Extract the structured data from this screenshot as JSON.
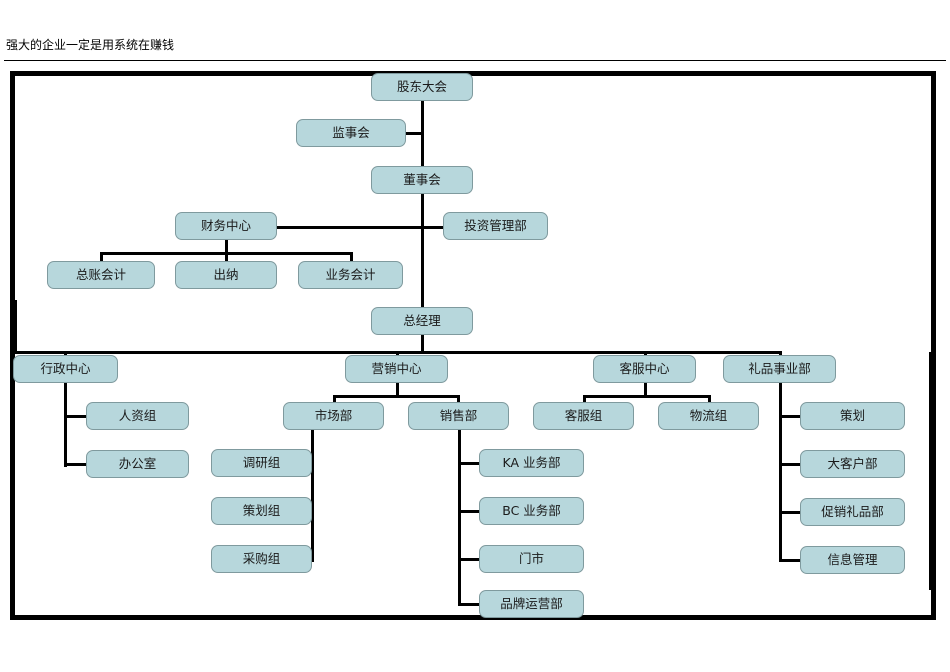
{
  "document": {
    "title": "强大的企业一定是用系统在赚钱"
  },
  "chart": {
    "type": "org-chart",
    "node_fill_color": "#b7d7dc",
    "node_border_color": "#7f9a9e",
    "connector_color": "#000000",
    "frame_border_color": "#000000",
    "nodes": {
      "shareholders_meeting": "股东大会",
      "supervisory_board": "监事会",
      "board_of_directors": "董事会",
      "finance_center": "财务中心",
      "investment_management": "投资管理部",
      "general_ledger_accounting": "总账会计",
      "cashier": "出纳",
      "business_accounting": "业务会计",
      "general_manager": "总经理",
      "admin_center": "行政中心",
      "marketing_center": "营销中心",
      "customer_service_center": "客服中心",
      "gift_business_division": "礼品事业部",
      "hr_group": "人资组",
      "office": "办公室",
      "market_department": "市场部",
      "sales_department": "销售部",
      "customer_service_group": "客服组",
      "logistics_group": "物流组",
      "planning": "策划",
      "research_group": "调研组",
      "planning_group": "策划组",
      "purchasing_group": "采购组",
      "key_account_dept": "KA 业务部",
      "bc_business_dept": "BC 业务部",
      "retail_store": "门市",
      "brand_operations_dept": "品牌运营部",
      "key_customer_dept": "大客户部",
      "promotional_gift_dept": "促销礼品部",
      "information_management": "信息管理"
    },
    "hierarchy": {
      "股东大会": [
        "监事会",
        "董事会"
      ],
      "董事会": [
        "财务中心",
        "投资管理部",
        "总经理"
      ],
      "财务中心": [
        "总账会计",
        "出纳",
        "业务会计"
      ],
      "总经理": [
        "行政中心",
        "营销中心",
        "客服中心",
        "礼品事业部"
      ],
      "行政中心": [
        "人资组",
        "办公室"
      ],
      "营销中心": [
        "市场部",
        "销售部"
      ],
      "市场部": [
        "调研组",
        "策划组",
        "采购组"
      ],
      "销售部": [
        "KA 业务部",
        "BC 业务部",
        "门市",
        "品牌运营部"
      ],
      "客服中心": [
        "客服组",
        "物流组"
      ],
      "礼品事业部": [
        "策划",
        "大客户部",
        "促销礼品部",
        "信息管理"
      ]
    }
  }
}
